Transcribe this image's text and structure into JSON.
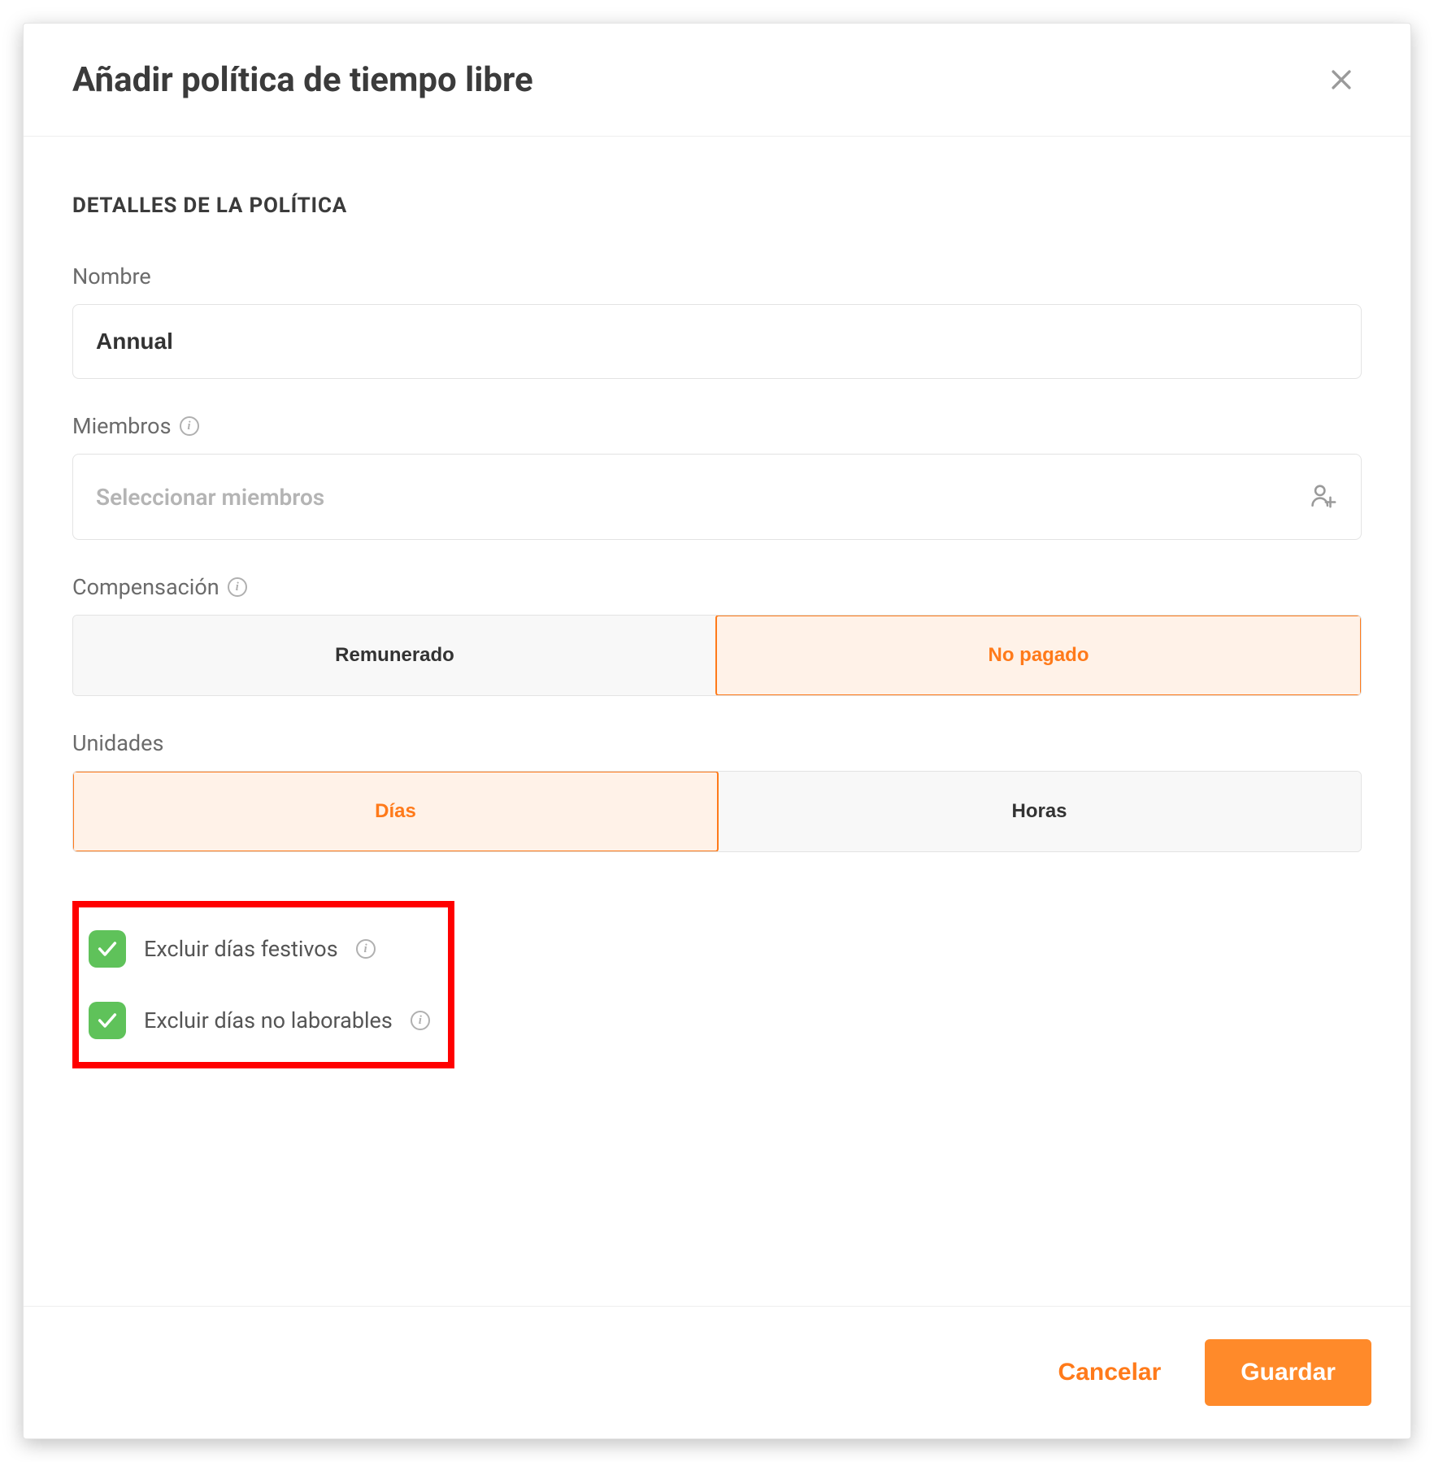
{
  "dialog": {
    "title": "Añadir política de tiempo libre",
    "section_heading": "DETALLES DE LA POLÍTICA"
  },
  "fields": {
    "name": {
      "label": "Nombre",
      "value": "Annual"
    },
    "members": {
      "label": "Miembros",
      "placeholder": "Seleccionar miembros"
    },
    "compensation": {
      "label": "Compensación",
      "options": {
        "paid": "Remunerado",
        "unpaid": "No pagado"
      },
      "selected": "unpaid"
    },
    "units": {
      "label": "Unidades",
      "options": {
        "days": "Días",
        "hours": "Horas"
      },
      "selected": "days"
    },
    "exclude_holidays": {
      "label": "Excluir días festivos",
      "checked": true
    },
    "exclude_nonworking": {
      "label": "Excluir días no laborables",
      "checked": true
    }
  },
  "footer": {
    "cancel": "Cancelar",
    "save": "Guardar"
  }
}
